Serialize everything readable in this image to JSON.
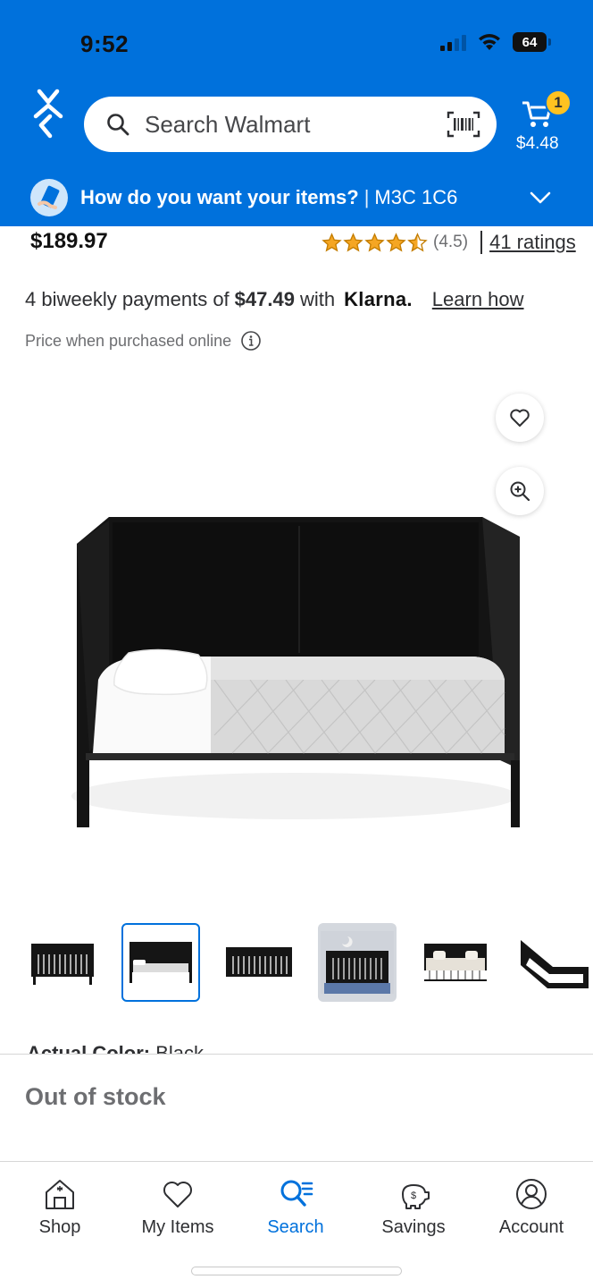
{
  "status_bar": {
    "time": "9:52",
    "battery": "64"
  },
  "header": {
    "search_placeholder": "Search Walmart",
    "cart_count": "1",
    "cart_total": "$4.48",
    "fulfillment_question": "How do you want your items?",
    "fulfillment_separator": "|",
    "fulfillment_postal": "M3C 1C6"
  },
  "product": {
    "price": "$189.97",
    "rating_value": "(4.5)",
    "rating_stars": 4.5,
    "rating_count": "41 ratings",
    "klarna_prefix": "4 biweekly payments of",
    "klarna_amount": "$47.49",
    "klarna_with": "with",
    "klarna_brand": "Klarna.",
    "klarna_link": "Learn how",
    "price_note": "Price when purchased online",
    "color_label": "Actual Color:",
    "color_value": "Black",
    "availability": "Out of stock",
    "thumbnail_selected_index": 1
  },
  "bottom_nav": {
    "items": [
      {
        "label": "Shop",
        "icon": "home-store-icon"
      },
      {
        "label": "My Items",
        "icon": "heart-icon"
      },
      {
        "label": "Search",
        "icon": "search-list-icon"
      },
      {
        "label": "Savings",
        "icon": "piggy-bank-icon"
      },
      {
        "label": "Account",
        "icon": "account-icon"
      }
    ],
    "active_index": 2
  },
  "colors": {
    "brand_blue": "#0071dc",
    "spark_yellow": "#ffc220",
    "text_dark": "#2e2f32",
    "text_muted": "#6d6e71"
  }
}
